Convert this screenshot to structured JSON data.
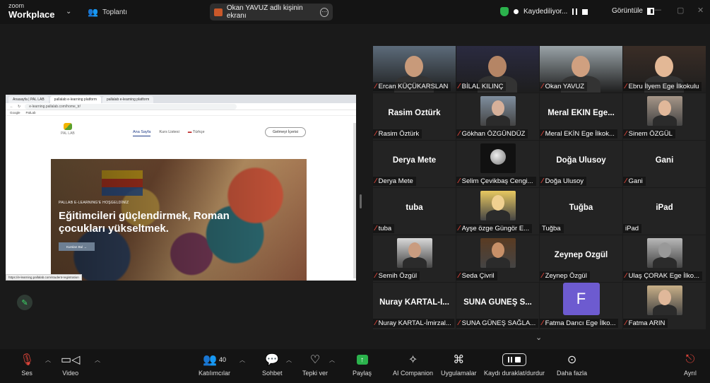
{
  "app": {
    "logo_top": "zoom",
    "logo_bottom": "Workplace",
    "meeting_title": "Toplantı"
  },
  "share_banner": {
    "text": "Okan YAVUZ adlı kişinin ekranı"
  },
  "recording": {
    "text": "Kaydediliyor..."
  },
  "view": {
    "label": "Görüntüle"
  },
  "browser": {
    "tabs": [
      "Anasayfa | PAL LAB",
      "pallalab e-learning platform",
      "pallalab e-learning platform"
    ],
    "url": "e-learning.pallalab.com/home_tr/",
    "bookmarks": [
      "Google",
      "PalLab"
    ],
    "site_logo": "PAL LAB",
    "nav": [
      "Ana Sayfa",
      "Kurs Listesi",
      "Türkçe"
    ],
    "cta": "Gelmeyi İçerisi",
    "hero_kicker": "PALLAB E-LEARNING'E HOŞGELDİNİZ",
    "hero_title": "Eğitimcileri güçlendirmek, Roman çocukları yükseltmek.",
    "hero_button": "Kursları Bul →",
    "status_url": "https://e-learning.pallalab.com/student-registration"
  },
  "participants": [
    {
      "name": "Ercan KÜÇÜKARSLAN",
      "video": true,
      "skin": "#c89a7a",
      "bg": "#5c6b7a"
    },
    {
      "name": "BİLAL KILINÇ",
      "video": true,
      "skin": "#b58565",
      "bg": "#2a2a40"
    },
    {
      "name": "Okan YAVUZ",
      "video": true,
      "skin": "#d0a080",
      "bg": "#9aa3a8",
      "active": true
    },
    {
      "name": "Ebru İlyem Ege İlkokulu",
      "video": true,
      "skin": "#e3b896",
      "bg": "#3a2d26"
    },
    {
      "name": "Rasim Öztürk",
      "video": false
    },
    {
      "name": "Gökhan ÖZGÜNDÜZ",
      "video": true,
      "thumb": true,
      "skin": "#d6b09a",
      "bg": "#7f8e9e"
    },
    {
      "name": "Meral EKİN Ege İlkok...",
      "big": "Meral EKİN Ege...",
      "video": false
    },
    {
      "name": "Sinem ÖZGÜL",
      "video": true,
      "thumb": true,
      "skin": "#e1b89a",
      "bg": "#a69688"
    },
    {
      "name": "Derya Mete",
      "video": false
    },
    {
      "name": "Selim Çevikbaş Cengi...",
      "video": true,
      "thumb": true,
      "moon": true
    },
    {
      "name": "Doğa Ulusoy",
      "video": false
    },
    {
      "name": "Gani",
      "video": false
    },
    {
      "name": "tuba",
      "video": false
    },
    {
      "name": "Ayşe özge Güngör E...",
      "video": true,
      "thumb": true,
      "skin": "#f0d090",
      "bg": "#e8c860"
    },
    {
      "name": "Tuğba",
      "video": false,
      "nomic": true
    },
    {
      "name": "iPad",
      "video": false,
      "nomic": true
    },
    {
      "name": "Semih Özgül",
      "video": true,
      "thumb": true,
      "skin": "#c99c80",
      "bg": "#d9d9d9"
    },
    {
      "name": "Seda Çivril",
      "video": true,
      "thumb": true,
      "skin": "#c89068",
      "bg": "#5a3b22"
    },
    {
      "name": "Zeynep Özgül",
      "video": false
    },
    {
      "name": "Ulaş ÇORAK Ege İlko...",
      "video": true,
      "thumb": true,
      "skin": "#999",
      "bg": "#b8b8b8"
    },
    {
      "name": "Nuray KARTAL-İmirzal...",
      "big": "Nuray KARTAL-İ...",
      "video": false
    },
    {
      "name": "SUNA GÜNEŞ SAĞLA...",
      "big": "SUNA GÜNEŞ S...",
      "video": false
    },
    {
      "name": "Fatma Darıcı Ege İlko...",
      "video": false,
      "avatar_letter": "F"
    },
    {
      "name": "Fatma ARIN",
      "video": true,
      "thumb": true,
      "skin": "#e0b89a",
      "bg": "#c9b088"
    }
  ],
  "toolbar": {
    "mic": "Ses",
    "video": "Video",
    "participants": "Katılımcılar",
    "participant_count": "40",
    "chat": "Sohbet",
    "react": "Tepki ver",
    "share": "Paylaş",
    "ai": "AI Companion",
    "apps": "Uygulamalar",
    "record": "Kaydı duraklat/durdur",
    "more": "Daha fazla",
    "leave": "Ayrıl"
  },
  "colors": {
    "active_speaker": "#3ddc6a",
    "share_green": "#2bb24c",
    "muted_red": "#e0453a",
    "avatar_purple": "#6d5bd0"
  }
}
